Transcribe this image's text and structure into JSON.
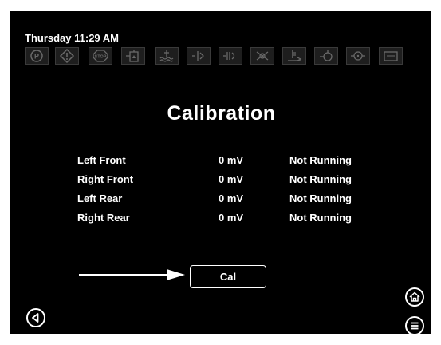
{
  "header": {
    "datetime": "Thursday 11:29 AM",
    "indicators": [
      "parking-brake-icon",
      "warning-icon",
      "stop-icon",
      "fuel-filter-icon",
      "coolant-level-icon",
      "pto-icon",
      "glow-plug-icon",
      "hydraulic-icon",
      "coolant-temp-icon",
      "engine-icon",
      "oil-pressure-icon",
      "battery-icon"
    ]
  },
  "main": {
    "title": "Calibration",
    "rows": [
      {
        "name": "Left Front",
        "value": "0 mV",
        "status": "Not Running"
      },
      {
        "name": "Right Front",
        "value": "0 mV",
        "status": "Not Running"
      },
      {
        "name": "Left Rear",
        "value": "0 mV",
        "status": "Not Running"
      },
      {
        "name": "Right Rear",
        "value": "0 mV",
        "status": "Not Running"
      }
    ],
    "cal_button": "Cal"
  },
  "footer": {
    "back_icon": "back-triangle-icon",
    "home_icon": "home-icon",
    "menu_icon": "menu-icon"
  },
  "colors": {
    "background": "#000000",
    "text": "#ffffff",
    "indicator_inactive": "#1e1e1e"
  }
}
